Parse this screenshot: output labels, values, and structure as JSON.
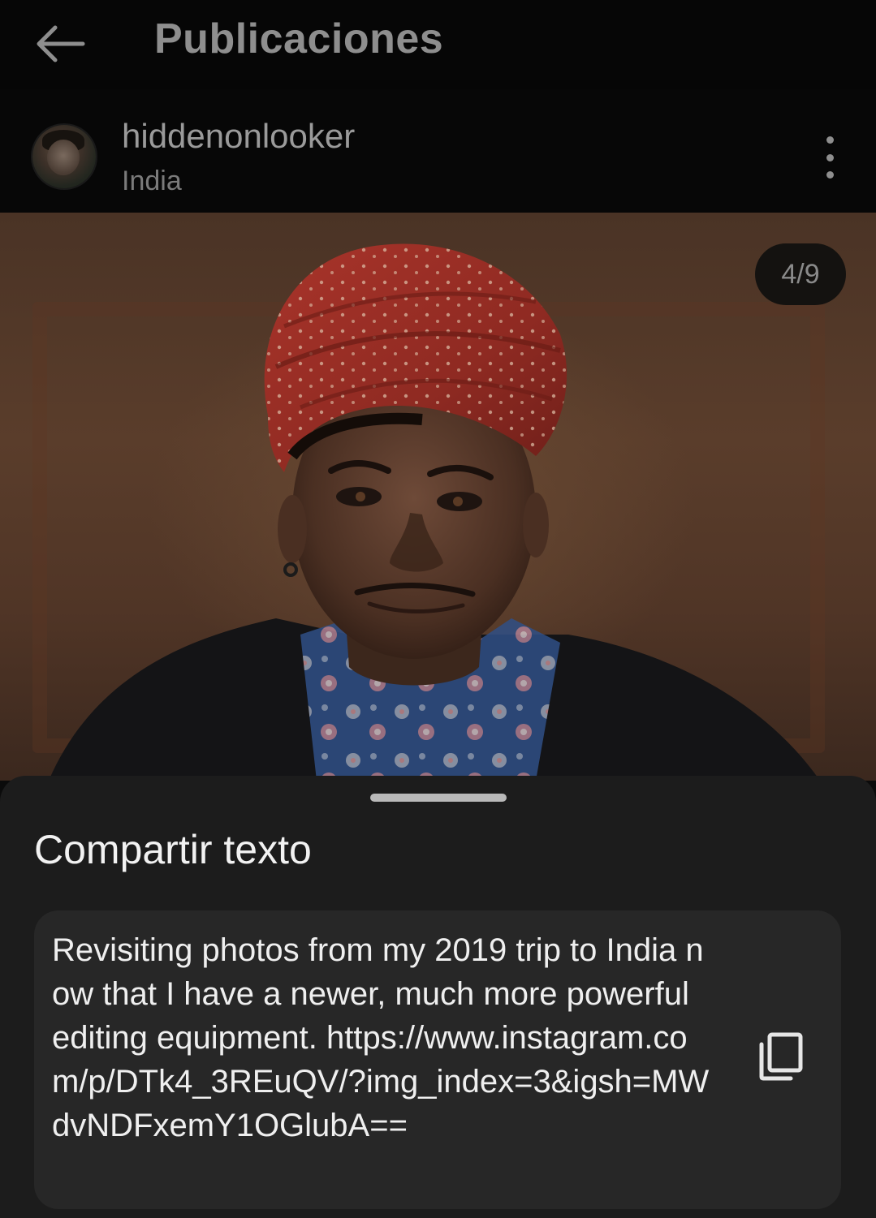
{
  "app_bar": {
    "title": "Publicaciones",
    "back_icon": "arrow-left-icon"
  },
  "post": {
    "username": "hiddenonlooker",
    "location": "India",
    "more_icon": "more-vertical-icon",
    "counter": "4/9",
    "image": "portrait-man-red-turban-photo"
  },
  "share_sheet": {
    "title": "Compartir texto",
    "text": "Revisiting photos from my 2019 trip to India now that I have a newer, much more powerful editing equipment. https://www.instagram.com/p/DTk4_3REuQV/?img_index=3&igsh=MWdvNDFxemY1OGlubA==",
    "copy_icon": "copy-icon"
  },
  "colors": {
    "sheet_background": "#1c1c1c",
    "text_card_background": "#272727",
    "dimmed_text": "#8e8e8e",
    "turban_red": "#b0342b"
  }
}
